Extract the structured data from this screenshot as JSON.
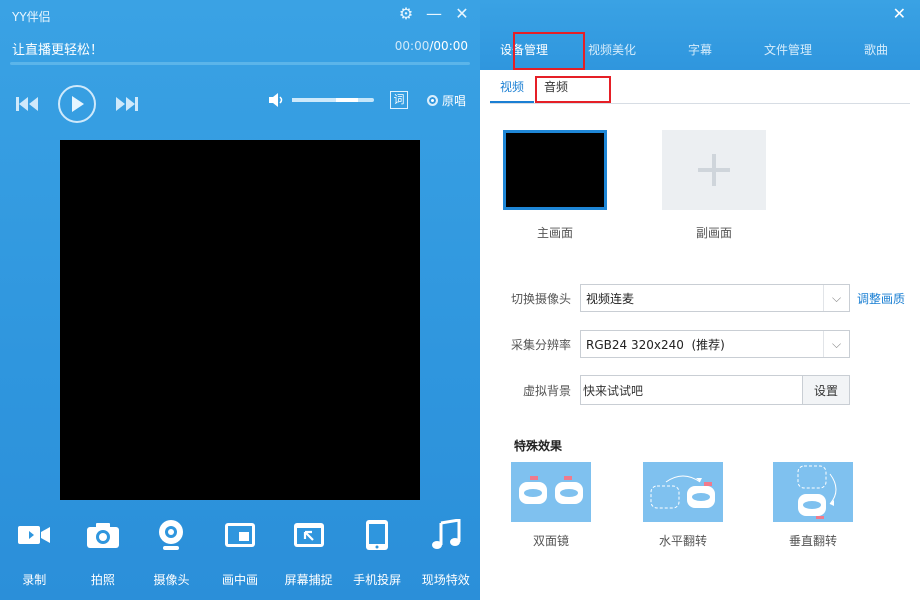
{
  "app": {
    "title": "YY伴侣"
  },
  "header": {
    "slogan": "让直播更轻松！",
    "time_current": "00:00",
    "time_total": "/00:00"
  },
  "playback": {
    "progress": 0.0,
    "volume": 0.7
  },
  "controls": {
    "lyric_label": "词",
    "original_label": "原唱"
  },
  "tools": [
    {
      "label": "录制",
      "icon": "video-camera-icon"
    },
    {
      "label": "拍照",
      "icon": "camera-icon"
    },
    {
      "label": "摄像头",
      "icon": "webcam-icon"
    },
    {
      "label": "画中画",
      "icon": "picture-in-picture-icon"
    },
    {
      "label": "屏幕捕捉",
      "icon": "screen-capture-icon"
    },
    {
      "label": "手机投屏",
      "icon": "phone-icon"
    },
    {
      "label": "现场特效",
      "icon": "music-note-icon"
    }
  ],
  "right_tabs": [
    {
      "label": "设备管理",
      "active": true
    },
    {
      "label": "视频美化",
      "active": false
    },
    {
      "label": "字幕",
      "active": false
    },
    {
      "label": "文件管理",
      "active": false
    },
    {
      "label": "歌曲",
      "active": false
    }
  ],
  "sub_tabs": [
    {
      "label": "视频",
      "active": true
    },
    {
      "label": "音频",
      "active": false
    }
  ],
  "screens": {
    "main_label": "主画面",
    "sub_label": "副画面"
  },
  "form": {
    "camera_label": "切换摄像头",
    "camera_value": "视频连麦",
    "adjust_quality": "调整画质",
    "resolution_label": "采集分辨率",
    "resolution_value": "RGB24 320x240  (推荐)",
    "background_label": "虚拟背景",
    "background_value": "快来试试吧",
    "settings_button": "设置"
  },
  "effects": {
    "title": "特殊效果",
    "items": [
      {
        "label": "双面镜"
      },
      {
        "label": "水平翻转"
      },
      {
        "label": "垂直翻转"
      }
    ]
  },
  "colors": {
    "accent": "#2f96de",
    "highlight": "#e51f26",
    "link": "#1a7fd3"
  }
}
